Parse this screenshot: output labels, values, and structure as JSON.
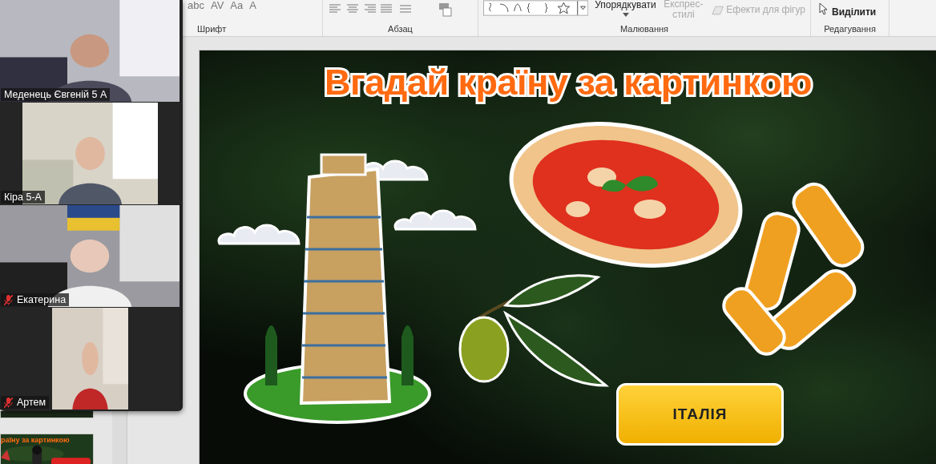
{
  "ribbon": {
    "font_tools": [
      {
        "label": "abc"
      },
      {
        "label": "AV"
      },
      {
        "label": "Aa"
      },
      {
        "label": "A"
      }
    ],
    "commands": [
      {
        "label": "Упорядкувати",
        "disabled": false
      },
      {
        "label": "Експрес-стилі",
        "disabled": true
      },
      {
        "label": "Ефекти для фігур",
        "disabled": true
      },
      {
        "label": "Виділити",
        "disabled": false
      }
    ],
    "groups": [
      {
        "label": "Шрифт"
      },
      {
        "label": "Абзац"
      },
      {
        "label": "Малювання"
      },
      {
        "label": "Редагування"
      }
    ]
  },
  "participants": [
    {
      "name": "Меденець Євгеній 5 А",
      "muted": false
    },
    {
      "name": "Кіра 5-А",
      "muted": false
    },
    {
      "name": "Екатерина",
      "muted": true
    },
    {
      "name": "Артем",
      "muted": true
    }
  ],
  "slide_thumbnails": [
    {
      "title": "раїну за картинкою"
    }
  ],
  "slide": {
    "title": "Вгадай країну за картинкою",
    "answer_button": "ІТАЛІЯ"
  }
}
